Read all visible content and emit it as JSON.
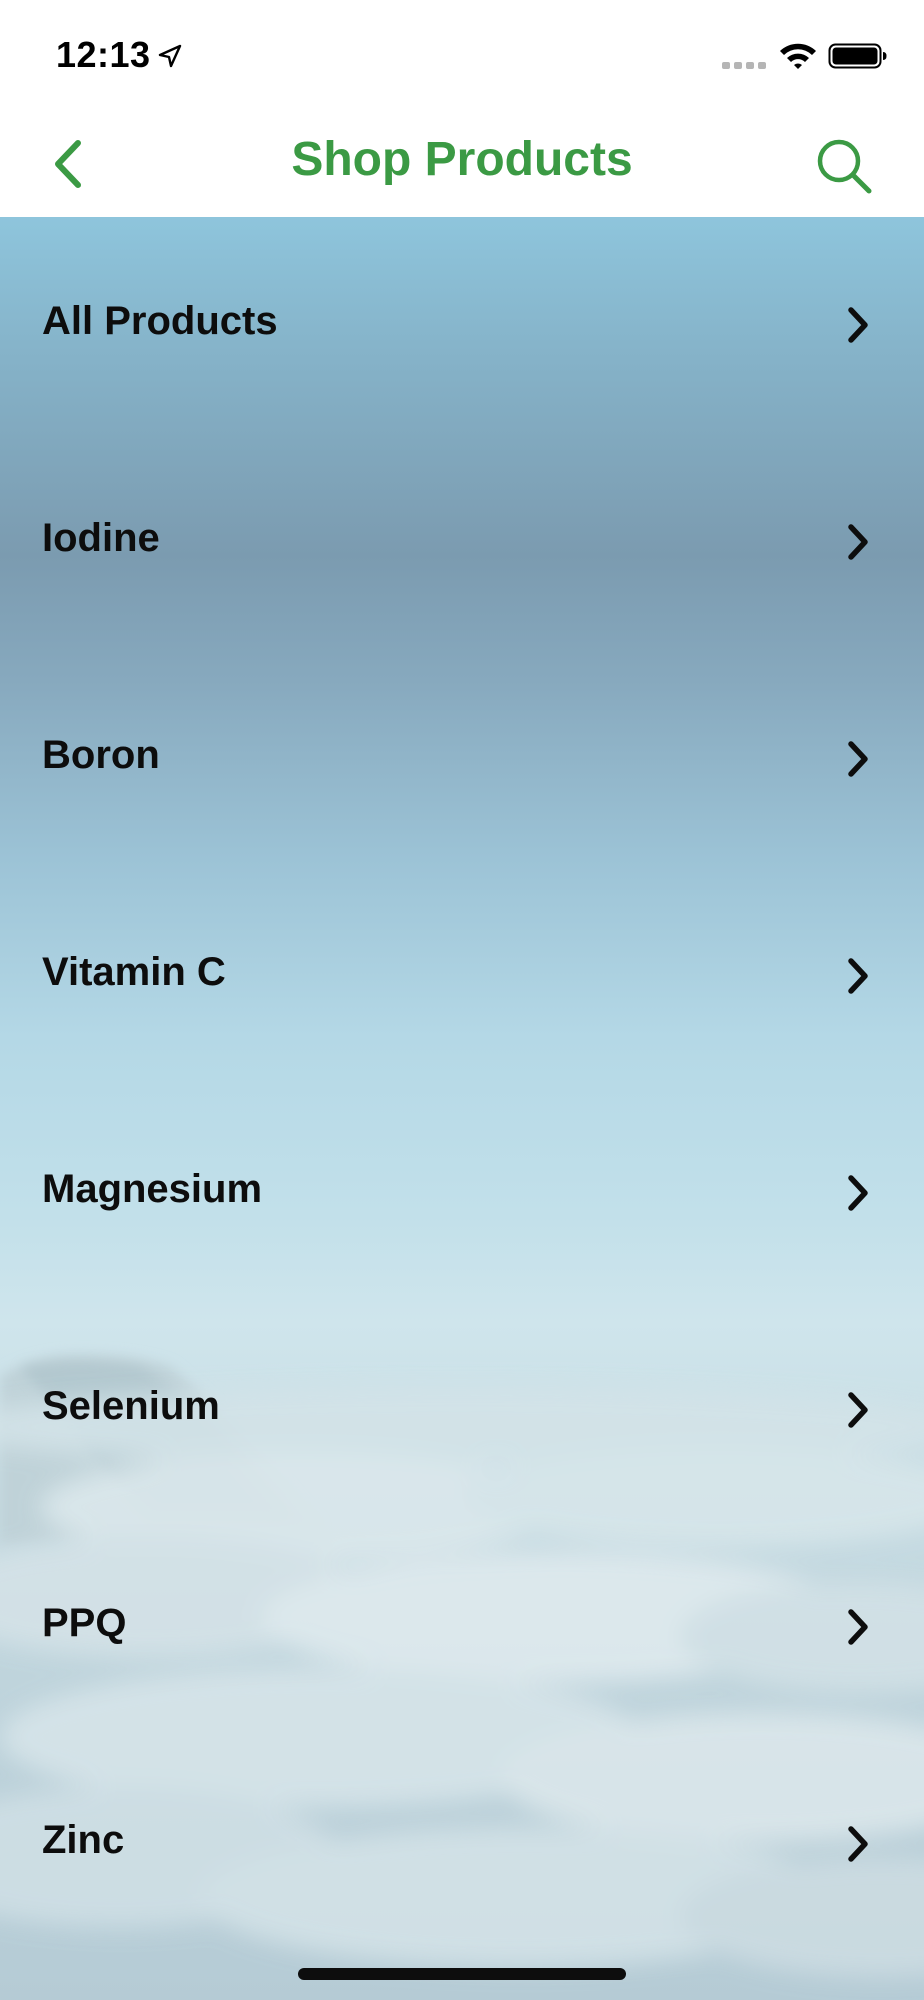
{
  "status_bar": {
    "time": "12:13",
    "location_icon": "location-arrow-icon",
    "signal_icon": "cellular-signal-icon",
    "wifi_icon": "wifi-icon",
    "battery_icon": "battery-icon"
  },
  "nav_bar": {
    "title": "Shop Products",
    "back_icon": "chevron-left-icon",
    "search_icon": "search-icon"
  },
  "colors": {
    "accent": "#3b9a44",
    "text": "#0d0d0d"
  },
  "products": [
    {
      "label": "All Products"
    },
    {
      "label": "Iodine"
    },
    {
      "label": "Boron"
    },
    {
      "label": "Vitamin C"
    },
    {
      "label": "Magnesium"
    },
    {
      "label": "Selenium"
    },
    {
      "label": "PPQ"
    },
    {
      "label": "Zinc"
    }
  ]
}
